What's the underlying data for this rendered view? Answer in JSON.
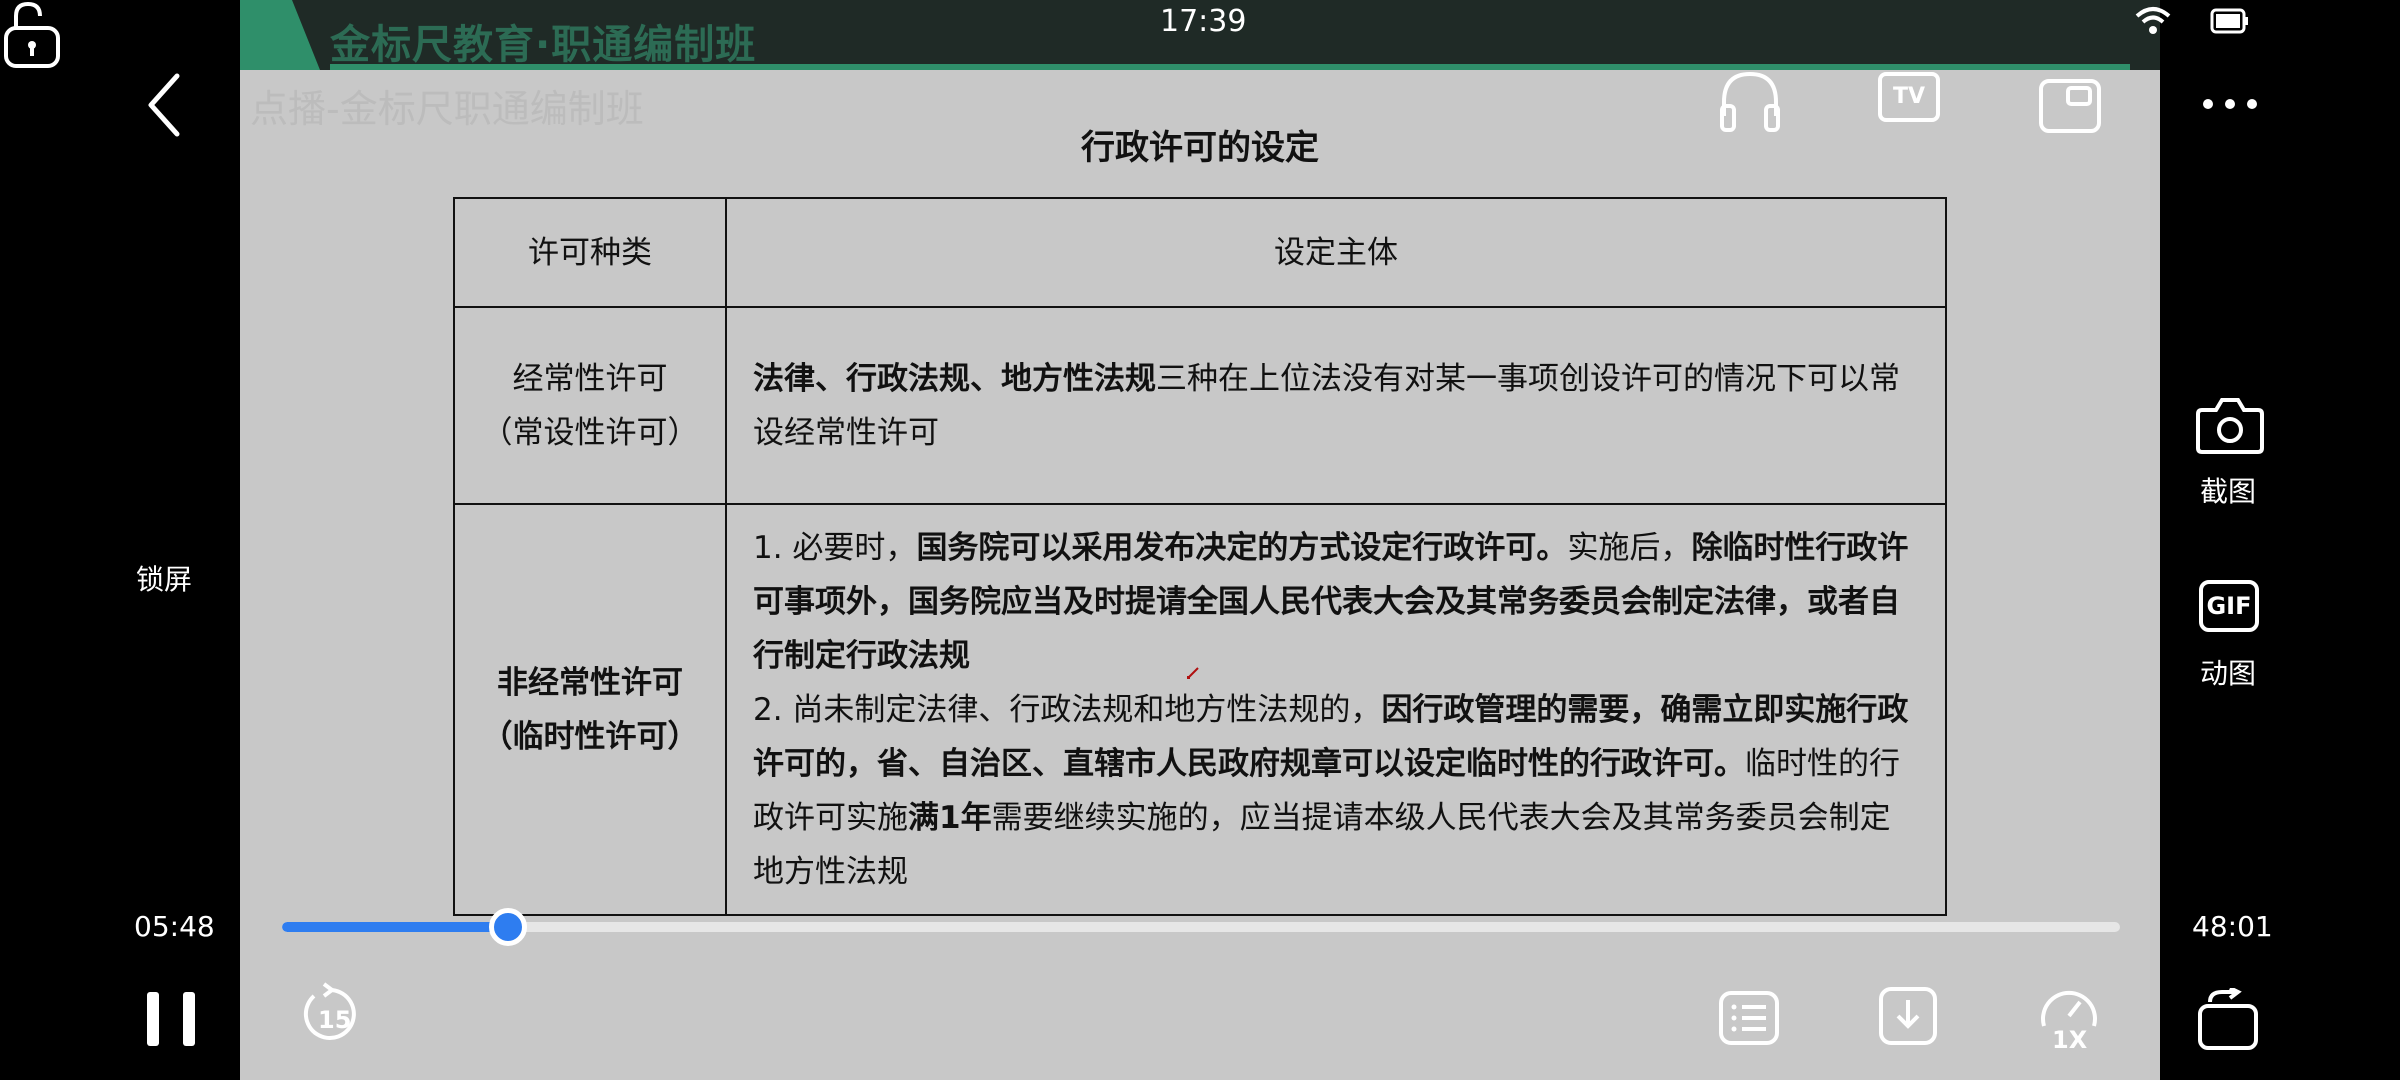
{
  "status_bar": {
    "time": "17:39"
  },
  "slide": {
    "brand": "金标尺教育·职通编制班",
    "watermark": "点播-金标尺职通编制班",
    "title": "行政许可的设定",
    "table": {
      "headers": [
        "许可种类",
        "设定主体"
      ],
      "row1": {
        "type_line1": "经常性许可",
        "type_line2": "（常设性许可）",
        "bold": "法律、行政法规、地方性法规",
        "text": "三种在上位法没有对某一事项创设许可的情况下可以常设经常性许可"
      },
      "row2": {
        "type_line1": "非经常性许可",
        "type_line2": "（临时性许可）",
        "p1_a": "1. 必要时，",
        "p1_b": "国务院可以采用发布决定的方式设定行政许可。",
        "p1_c": "实施后，",
        "p1_d": "除临时性行政许可事项外，国务院应当及时提请全国人民代表大会及其常务委员会制定法律，或者自行制定行政法规",
        "p2_a": "2. 尚未制定法律、行政法规和地方性法规的，",
        "p2_b": "因行政管理的需要，确需立即实施行政许可的，省、自治区、直辖市人民政府规章可以设定临时性的行政许可。",
        "p2_c": "临时性的行政许可实施",
        "p2_d": "满1年",
        "p2_e": "需要继续实施的，应当提请本级人民代表大会及其常务委员会制定地方性法规"
      }
    }
  },
  "player": {
    "lock_label": "锁屏",
    "screenshot_label": "截图",
    "gif_label": "动图",
    "gif_icon_text": "GIF",
    "tv_icon_text": "TV",
    "current_time": "05:48",
    "total_time": "48:01",
    "progress": 0.12,
    "replay_seconds": "15",
    "speed": "1X",
    "accent_color": "#2e7df0"
  }
}
